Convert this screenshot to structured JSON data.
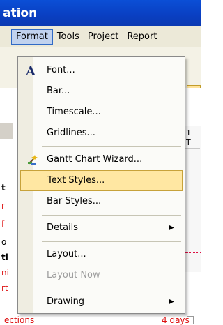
{
  "window": {
    "title": "ation"
  },
  "menubar": {
    "items": [
      {
        "label": "Format",
        "active": true
      },
      {
        "label": "Tools"
      },
      {
        "label": "Project"
      },
      {
        "label": "Report"
      }
    ]
  },
  "format_menu": {
    "items": [
      {
        "label": "Font...",
        "icon": "font-icon"
      },
      {
        "label": "Bar..."
      },
      {
        "label": "Timescale..."
      },
      {
        "label": "Gridlines..."
      },
      {
        "label": "Gantt Chart Wizard...",
        "icon": "wizard-icon"
      },
      {
        "label": "Text Styles...",
        "highlighted": true
      },
      {
        "label": "Bar Styles..."
      },
      {
        "label": "Details",
        "submenu": true
      },
      {
        "label": "Layout..."
      },
      {
        "label": "Layout Now",
        "disabled": true
      },
      {
        "label": "Drawing",
        "submenu": true
      }
    ]
  },
  "background": {
    "left_fragments": [
      "t",
      "r",
      "f",
      "o",
      "ti",
      "ni",
      "rt"
    ],
    "bottom_left": "ections",
    "bottom_right": "4 days",
    "right_header_1": "1",
    "right_header_2": "T"
  }
}
